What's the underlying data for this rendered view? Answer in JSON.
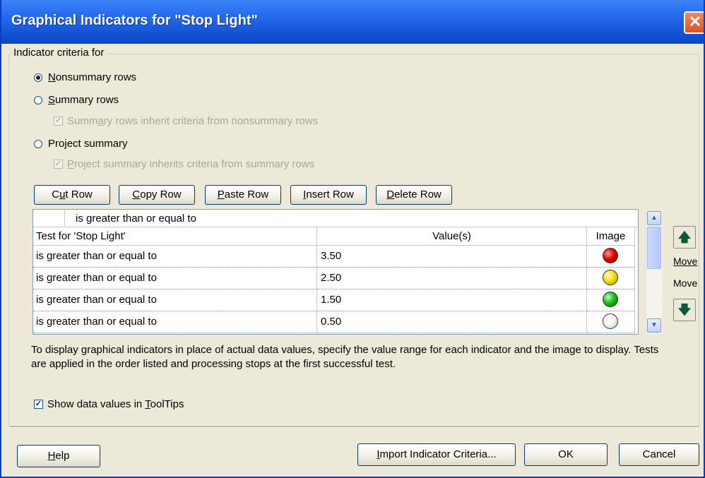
{
  "window": {
    "title": "Graphical Indicators for \"Stop Light\"",
    "close_glyph": "✕"
  },
  "criteria": {
    "legend": "Indicator criteria for",
    "nonsummary": {
      "pre": "",
      "key": "N",
      "post": "onsummary rows",
      "checked": true
    },
    "summary": {
      "pre": "",
      "key": "S",
      "post": "ummary rows",
      "checked": false
    },
    "summary_inherit": {
      "pre": "Summ",
      "key": "a",
      "post": "ry rows inherit criteria from nonsummary rows",
      "checked": true,
      "enabled": false
    },
    "project": {
      "pre": "Pro",
      "key": "j",
      "post": "ect summary",
      "checked": false
    },
    "project_inherit": {
      "pre": "",
      "key": "P",
      "post": "roject summary inherits criteria from summary rows",
      "checked": true,
      "enabled": false
    }
  },
  "toolbar": {
    "cut": {
      "pre": "C",
      "key": "u",
      "post": "t Row"
    },
    "copy": {
      "pre": "",
      "key": "C",
      "post": "opy Row"
    },
    "paste": {
      "pre": "",
      "key": "P",
      "post": "aste Row"
    },
    "insert": {
      "pre": "",
      "key": "I",
      "post": "nsert Row"
    },
    "delete": {
      "pre": "",
      "key": "D",
      "post": "elete Row"
    }
  },
  "grid": {
    "edit_value": "is greater than or equal to",
    "headers": {
      "test": "Test for 'Stop Light'",
      "value": "Value(s)",
      "image": "Image"
    },
    "rows": [
      {
        "test": "is greater than or equal to",
        "value": "3.50",
        "image": "red-ball"
      },
      {
        "test": "is greater than or equal to",
        "value": "2.50",
        "image": "yellow-ball"
      },
      {
        "test": "is greater than or equal to",
        "value": "1.50",
        "image": "green-ball"
      },
      {
        "test": "is greater than or equal to",
        "value": "0.50",
        "image": "white-ball"
      }
    ]
  },
  "move": {
    "up_label": "Move",
    "down_label": "Move",
    "up_icon": "arrow-up-icon",
    "down_icon": "arrow-down-icon"
  },
  "description": "To display graphical indicators in place of actual data values, specify the value range for each indicator and the image to display.  Tests are applied in the order listed and processing stops at the first successful test.",
  "tooltips": {
    "pre": "Show data values in ",
    "key": "T",
    "post": "oolTips",
    "checked": true
  },
  "buttons": {
    "help": {
      "pre": "",
      "key": "H",
      "post": "elp"
    },
    "import": {
      "pre": "",
      "key": "I",
      "post": "mport Indicator Criteria..."
    },
    "ok": "OK",
    "cancel": "Cancel"
  },
  "colors": {
    "titlebar": "#1657d8",
    "dialog_bg": "#ece9d8",
    "close": "#d9532a"
  }
}
